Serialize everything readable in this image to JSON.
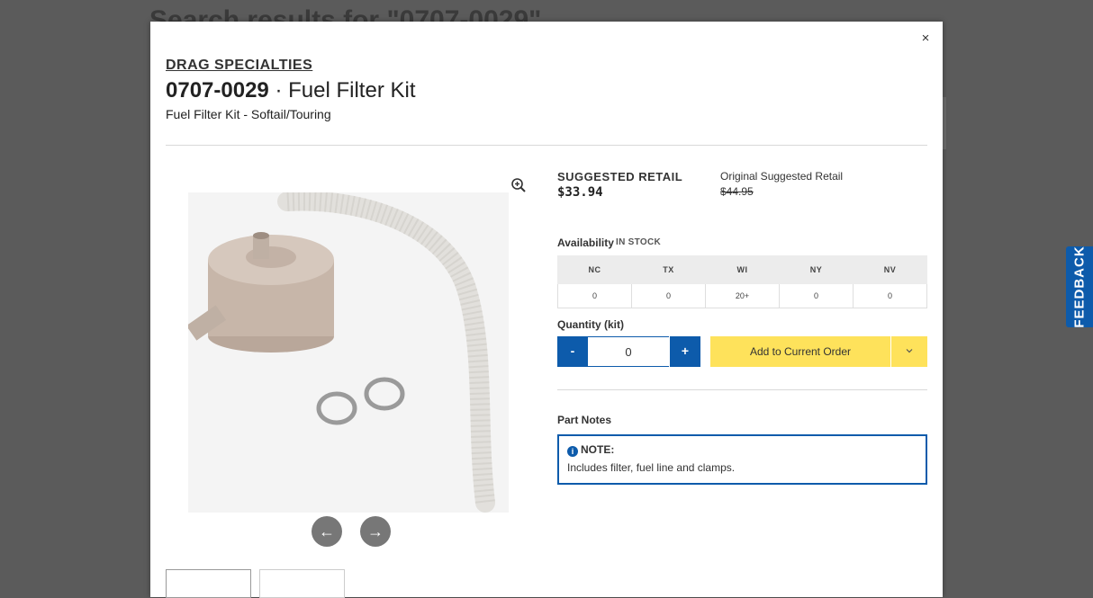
{
  "background": {
    "page_title": "Search results for \"0707-0029\"",
    "accent": "#0d5bab"
  },
  "feedback": {
    "label": "FEEDBACK"
  },
  "modal": {
    "close_label": "×",
    "brand": "DRAG SPECIALTIES",
    "part_number": "0707-0029",
    "separator": "·",
    "name": "Fuel Filter Kit",
    "subtitle": "Fuel Filter Kit - Softail/Touring",
    "gallery": {
      "prev_label": "←",
      "next_label": "→",
      "zoom_icon": "zoom-in-icon"
    },
    "pricing": {
      "suggested_label": "SUGGESTED RETAIL",
      "suggested_value": "$33.94",
      "original_label": "Original Suggested Retail",
      "original_value": "$44.95"
    },
    "availability": {
      "label": "Availability",
      "status": "IN STOCK",
      "warehouses": [
        "NC",
        "TX",
        "WI",
        "NY",
        "NV"
      ],
      "quantities": [
        "0",
        "0",
        "20+",
        "0",
        "0"
      ]
    },
    "quantity": {
      "label": "Quantity (kit)",
      "minus": "-",
      "plus": "+",
      "value": "0"
    },
    "add_to_order": {
      "label": "Add to Current Order",
      "dropdown_icon": "chevron-down-icon",
      "color": "#fee25b"
    },
    "notes": {
      "label": "Part Notes",
      "heading": "NOTE:",
      "text": "Includes filter, fuel line and clamps."
    }
  }
}
